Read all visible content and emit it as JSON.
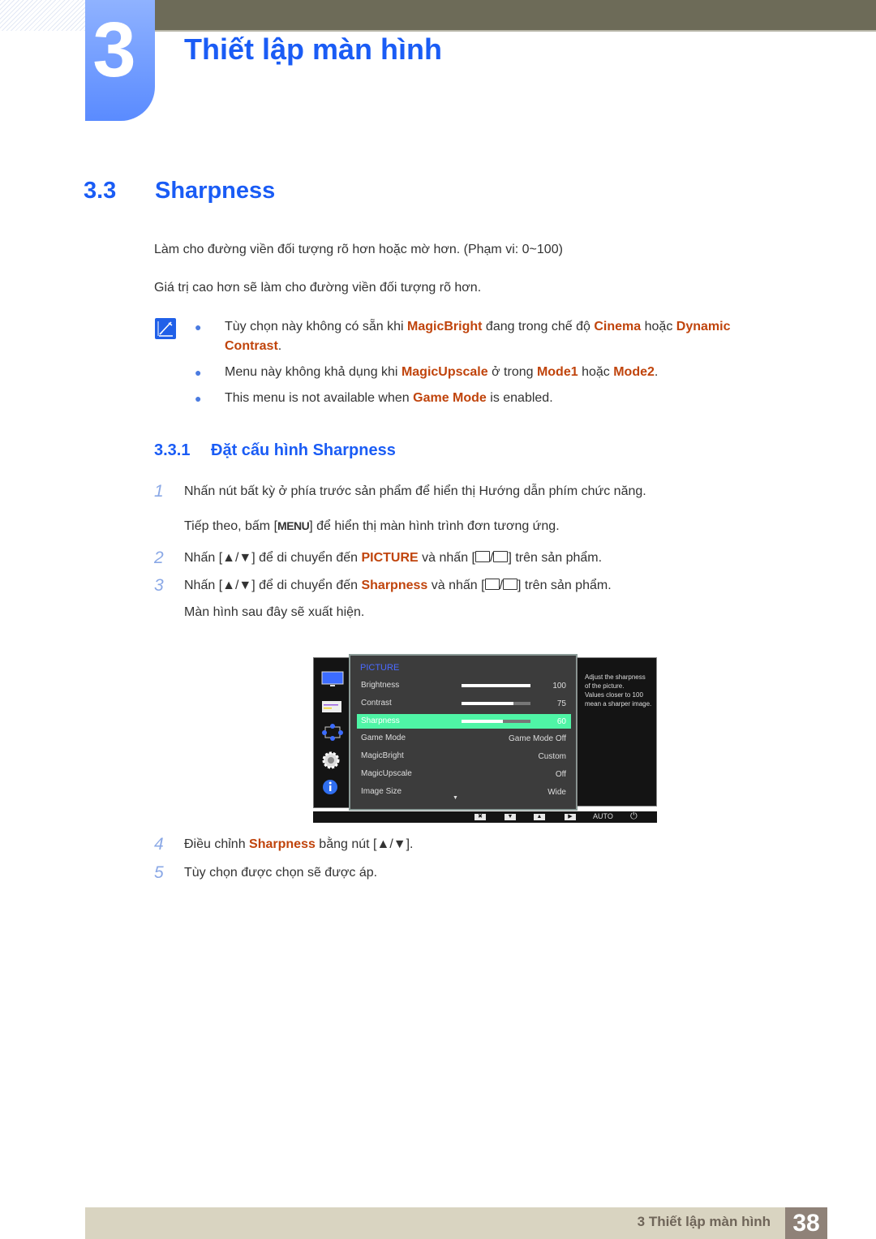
{
  "header": {
    "chapter_number": "3",
    "chapter_title": "Thiết lập màn hình"
  },
  "section": {
    "number": "3.3",
    "title": "Sharpness",
    "paragraphs": [
      "Làm cho đường viền đối tượng rõ hơn hoặc mờ hơn. (Phạm vi: 0~100)",
      "Giá trị cao hơn sẽ làm cho đường viền đối tượng rõ hơn."
    ]
  },
  "notes": [
    {
      "parts": [
        "Tùy chọn này không có sẵn khi ",
        "MagicBright",
        " đang trong chế độ ",
        "Cinema",
        " hoặc ",
        "Dynamic Contrast",
        "."
      ]
    },
    {
      "parts": [
        "Menu này không khả dụng khi ",
        "MagicUpscale",
        " ở trong ",
        "Mode1",
        " hoặc ",
        "Mode2",
        "."
      ]
    },
    {
      "parts": [
        "This menu is not available when ",
        "Game Mode",
        " is enabled."
      ]
    }
  ],
  "subsection": {
    "number": "3.3.1",
    "title": "Đặt cấu hình Sharpness"
  },
  "steps": [
    {
      "num": "1",
      "text": "Nhấn nút bất kỳ ở phía trước sản phẩm để hiển thị Hướng dẫn phím chức năng."
    },
    {
      "num": "",
      "pre": "Tiếp theo, bấm [",
      "key": "MENU",
      "post": "] để hiển thị màn hình trình đơn tương ứng."
    },
    {
      "num": "2",
      "pre": "Nhấn [▲/▼] để di chuyển đến ",
      "hl": "PICTURE",
      "mid": " và nhấn [",
      "post": "] trên sản phẩm."
    },
    {
      "num": "3",
      "pre": "Nhấn [▲/▼] để di chuyển đến ",
      "hl": "Sharpness",
      "mid": " và nhấn [",
      "post": "] trên sản phẩm."
    },
    {
      "num": "",
      "text": "Màn hình sau đây sẽ xuất hiện."
    },
    {
      "num": "4",
      "pre": "Điều chỉnh ",
      "hl": "Sharpness",
      "post": " bằng nút [▲/▼]."
    },
    {
      "num": "5",
      "text": "Tùy chọn được chọn sẽ được áp."
    }
  ],
  "osd": {
    "title": "PICTURE",
    "rows": [
      {
        "label": "Brightness",
        "value": "100",
        "level": 100
      },
      {
        "label": "Contrast",
        "value": "75",
        "level": 75
      },
      {
        "label": "Sharpness",
        "value": "60",
        "level": 60,
        "selected": true
      },
      {
        "label": "Game Mode",
        "value": "Game Mode Off"
      },
      {
        "label": "MagicBright",
        "value": "Custom"
      },
      {
        "label": "MagicUpscale",
        "value": "Off"
      },
      {
        "label": "Image Size",
        "value": "Wide"
      }
    ],
    "help": [
      "Adjust the sharpness",
      "of the picture.",
      "Values closer to 100",
      "mean a sharper image."
    ],
    "bottom": {
      "close": "✖",
      "down": "▼",
      "up": "▲",
      "right": "▶",
      "auto": "AUTO",
      "power": "⏻"
    },
    "scroll_indicator": "▼"
  },
  "footer": {
    "chapter_label": "3 Thiết lập màn hình",
    "page_number": "38"
  }
}
